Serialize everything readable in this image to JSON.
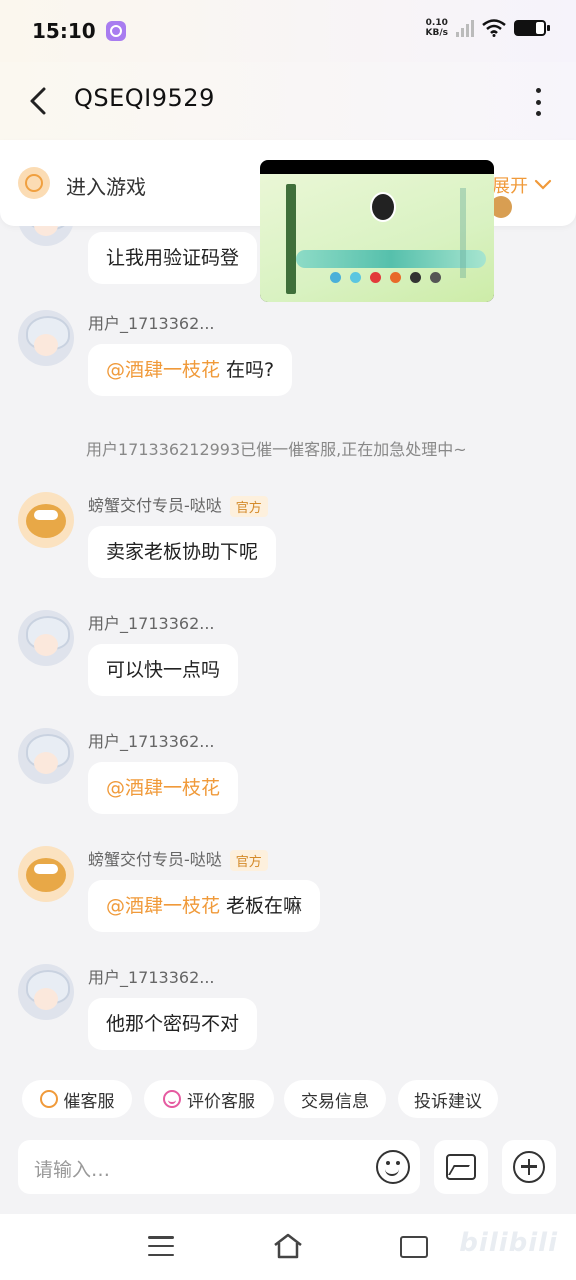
{
  "status_bar": {
    "time": "15:10",
    "net_speed_value": "0.10",
    "net_speed_unit": "KB/s"
  },
  "header": {
    "title": "QSEQI9529"
  },
  "game_banner": {
    "text": "进入游戏",
    "expand_label": "展开"
  },
  "messages": [
    {
      "sender": "",
      "text": "让我用验证码登"
    },
    {
      "sender": "用户_1713362...",
      "mention": "@酒肆一枝花",
      "text": "在吗?"
    },
    {
      "system": "用户171336212993已催一催客服,正在加急处理中~"
    },
    {
      "sender": "螃蟹交付专员-哒哒",
      "badge": "官方",
      "text": "卖家老板协助下呢"
    },
    {
      "sender": "用户_1713362...",
      "text": "可以快一点吗"
    },
    {
      "sender": "用户_1713362...",
      "mention": "@酒肆一枝花",
      "text": ""
    },
    {
      "sender": "螃蟹交付专员-哒哒",
      "badge": "官方",
      "mention": "@酒肆一枝花",
      "text": "老板在嘛"
    },
    {
      "sender": "用户_1713362...",
      "text": "他那个密码不对"
    }
  ],
  "quick_actions": [
    {
      "label": "催客服",
      "icon": "alarm-clock-icon"
    },
    {
      "label": "评价客服",
      "icon": "smile-icon"
    },
    {
      "label": "交易信息",
      "icon": ""
    },
    {
      "label": "投诉建议",
      "icon": ""
    }
  ],
  "input": {
    "placeholder": "请输入…"
  },
  "watermark": "bilibili",
  "colors": {
    "accent_orange": "#f09a3a",
    "official_badge_bg": "#fdf0dd",
    "background": "#f3f3f5"
  }
}
